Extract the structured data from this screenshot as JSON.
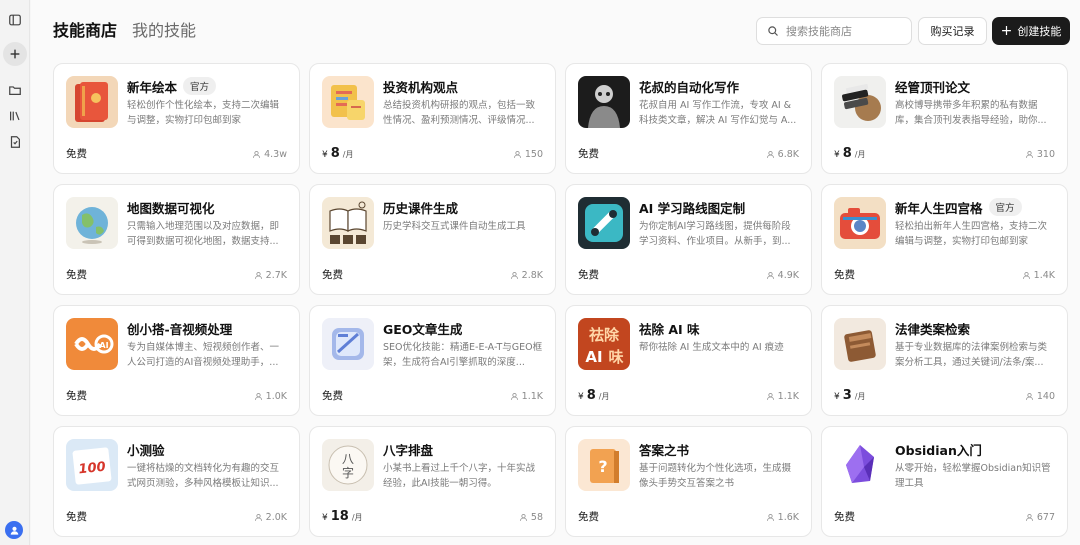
{
  "tabs": {
    "active": "技能商店",
    "inactive": "我的技能"
  },
  "search": {
    "placeholder": "搜索技能商店"
  },
  "buttons": {
    "history": "购买记录",
    "create": "创建技能",
    "create_icon": "+"
  },
  "price_labels": {
    "yen": "¥",
    "per_month": "/月"
  },
  "cards": [
    {
      "title": "新年绘本",
      "badge": "官方",
      "desc": "轻松创作个性化绘本，支持二次编辑与调整，实物打印包邮到家",
      "price_text": "免费",
      "price_amount": "",
      "users": "4.3w",
      "thumb": "red-book"
    },
    {
      "title": "投资机构观点",
      "badge": "",
      "desc": "总结投资机构研报的观点，包括一致性情况、盈利预测情况、评级情况...",
      "price_text": "",
      "price_amount": "8",
      "users": "150",
      "thumb": "notes"
    },
    {
      "title": "花叔的自动化写作",
      "badge": "",
      "desc": "花叔自用 AI 写作工作流，专攻 AI & 科技类文章，解决 AI 写作幻觉与 A...",
      "price_text": "免费",
      "price_amount": "",
      "users": "6.8K",
      "thumb": "portrait"
    },
    {
      "title": "经管顶刊论文",
      "badge": "",
      "desc": "高校博导携带多年积累的私有数据库，集合顶刊发表指导经验，助你...",
      "price_text": "",
      "price_amount": "8",
      "users": "310",
      "thumb": "books-globe"
    },
    {
      "title": "地图数据可视化",
      "badge": "",
      "desc": "只需输入地理范围以及对应数据，即可得到数据可视化地图，数据支持...",
      "price_text": "免费",
      "price_amount": "",
      "users": "2.7K",
      "thumb": "globe"
    },
    {
      "title": "历史课件生成",
      "badge": "",
      "desc": "历史学科交互式课件自动生成工具",
      "price_text": "免费",
      "price_amount": "",
      "users": "2.8K",
      "thumb": "history"
    },
    {
      "title": "AI 学习路线图定制",
      "badge": "",
      "desc": "为你定制AI学习路线图，提供每阶段学习资料、作业项目。从新手，到...",
      "price_text": "免费",
      "price_amount": "",
      "users": "4.9K",
      "thumb": "tools"
    },
    {
      "title": "新年人生四宫格",
      "badge": "官方",
      "desc": "轻松拍出新年人生四宫格，支持二次编辑与调整，实物打印包邮到家",
      "price_text": "免费",
      "price_amount": "",
      "users": "1.4K",
      "thumb": "camera"
    },
    {
      "title": "创小搭-音视频处理",
      "badge": "",
      "desc": "专为自媒体博主、短视频创作者、一人公司打造的AI音视频处理助手，...",
      "price_text": "免费",
      "price_amount": "",
      "users": "1.0K",
      "thumb": "infinity-ai"
    },
    {
      "title": "GEO文章生成",
      "badge": "",
      "desc": "SEO优化技能：精通E-E-A-T与GEO框架，生成符合AI引擎抓取的深度...",
      "price_text": "免费",
      "price_amount": "",
      "users": "1.1K",
      "thumb": "geo-doc"
    },
    {
      "title": "祛除 AI 味",
      "badge": "",
      "desc": "帮你祛除 AI 生成文本中的 AI 痕迹",
      "price_text": "",
      "price_amount": "8",
      "users": "1.1K",
      "thumb": "remove-ai"
    },
    {
      "title": "法律类案检索",
      "badge": "",
      "desc": "基于专业数据库的法律案例检索与类案分析工具，通过关键词/法条/案...",
      "price_text": "",
      "price_amount": "3",
      "users": "140",
      "thumb": "law-book"
    },
    {
      "title": "小测验",
      "badge": "",
      "desc": "一键将枯燥的文档转化为有趣的交互式网页测验，多种风格模板让知识...",
      "price_text": "免费",
      "price_amount": "",
      "users": "2.0K",
      "thumb": "quiz"
    },
    {
      "title": "八字排盘",
      "badge": "",
      "desc": "小某书上看过上千个八字，十年实战经验，此AI技能一朝习得。",
      "price_text": "",
      "price_amount": "18",
      "users": "58",
      "thumb": "bazi"
    },
    {
      "title": "答案之书",
      "badge": "",
      "desc": "基于问题转化为个性化选项，生成摄像头手势交互答案之书",
      "price_text": "免费",
      "price_amount": "",
      "users": "1.6K",
      "thumb": "answer-book"
    },
    {
      "title": "Obsidian入门",
      "badge": "",
      "desc": "从零开始，轻松掌握Obsidian知识管理工具",
      "price_text": "免费",
      "price_amount": "",
      "users": "677",
      "thumb": "obsidian"
    }
  ],
  "thumb_text": {
    "quiz": "100",
    "bazi_1": "八",
    "bazi_2": "字",
    "remove_ai_1": "祛除",
    "remove_ai_2": "AI",
    "remove_ai_3": "味",
    "infinity": "AI"
  }
}
